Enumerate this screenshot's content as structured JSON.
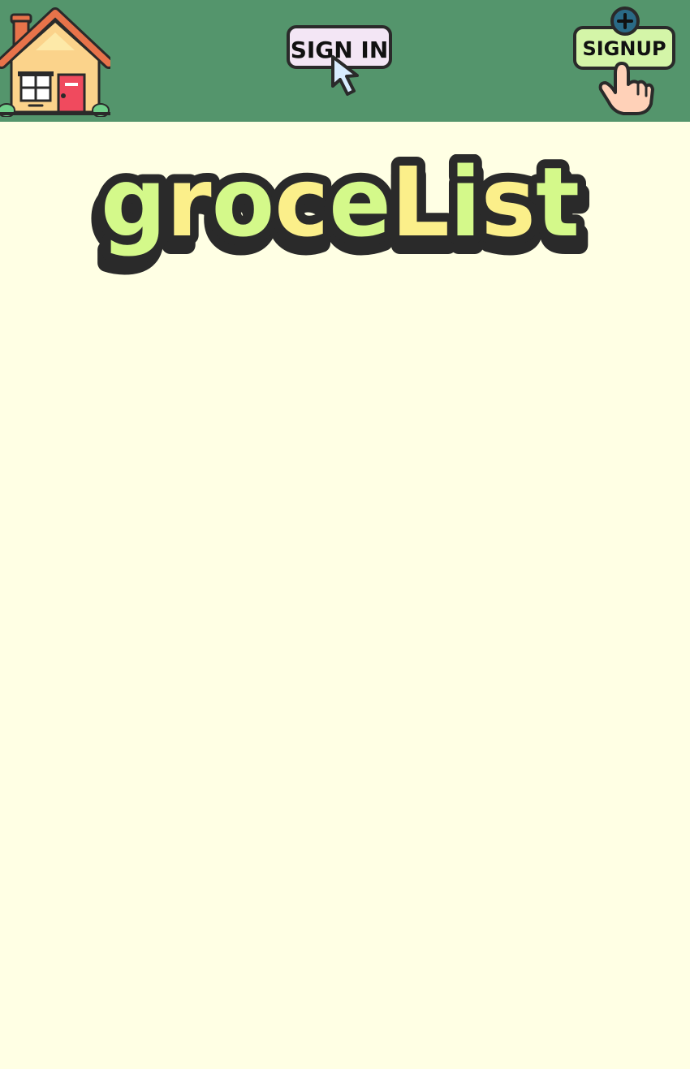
{
  "nav": {
    "home_icon": "house-icon",
    "signin_label": "SIGN IN",
    "signin_icon": "cursor-arrow-icon",
    "signup_label": "SIGNUP",
    "signup_icon": "plus-circle-icon",
    "signup_pointer_icon": "pointing-hand-icon"
  },
  "title": {
    "text": "groceList",
    "letters": [
      "g",
      "r",
      "o",
      "c",
      "e",
      "L",
      "i",
      "s",
      "t"
    ]
  },
  "colors": {
    "navbar": "#54956c",
    "background": "#ffffe4",
    "title_green": "#d4f98a",
    "title_yellow": "#fbef8a",
    "title_outline": "#2a2a2a",
    "signin_button": "#f3e6f5",
    "signup_button": "#d4f5a8",
    "house_roof": "#e8734a",
    "house_wall": "#fbd38b",
    "house_door": "#f04a5e"
  }
}
